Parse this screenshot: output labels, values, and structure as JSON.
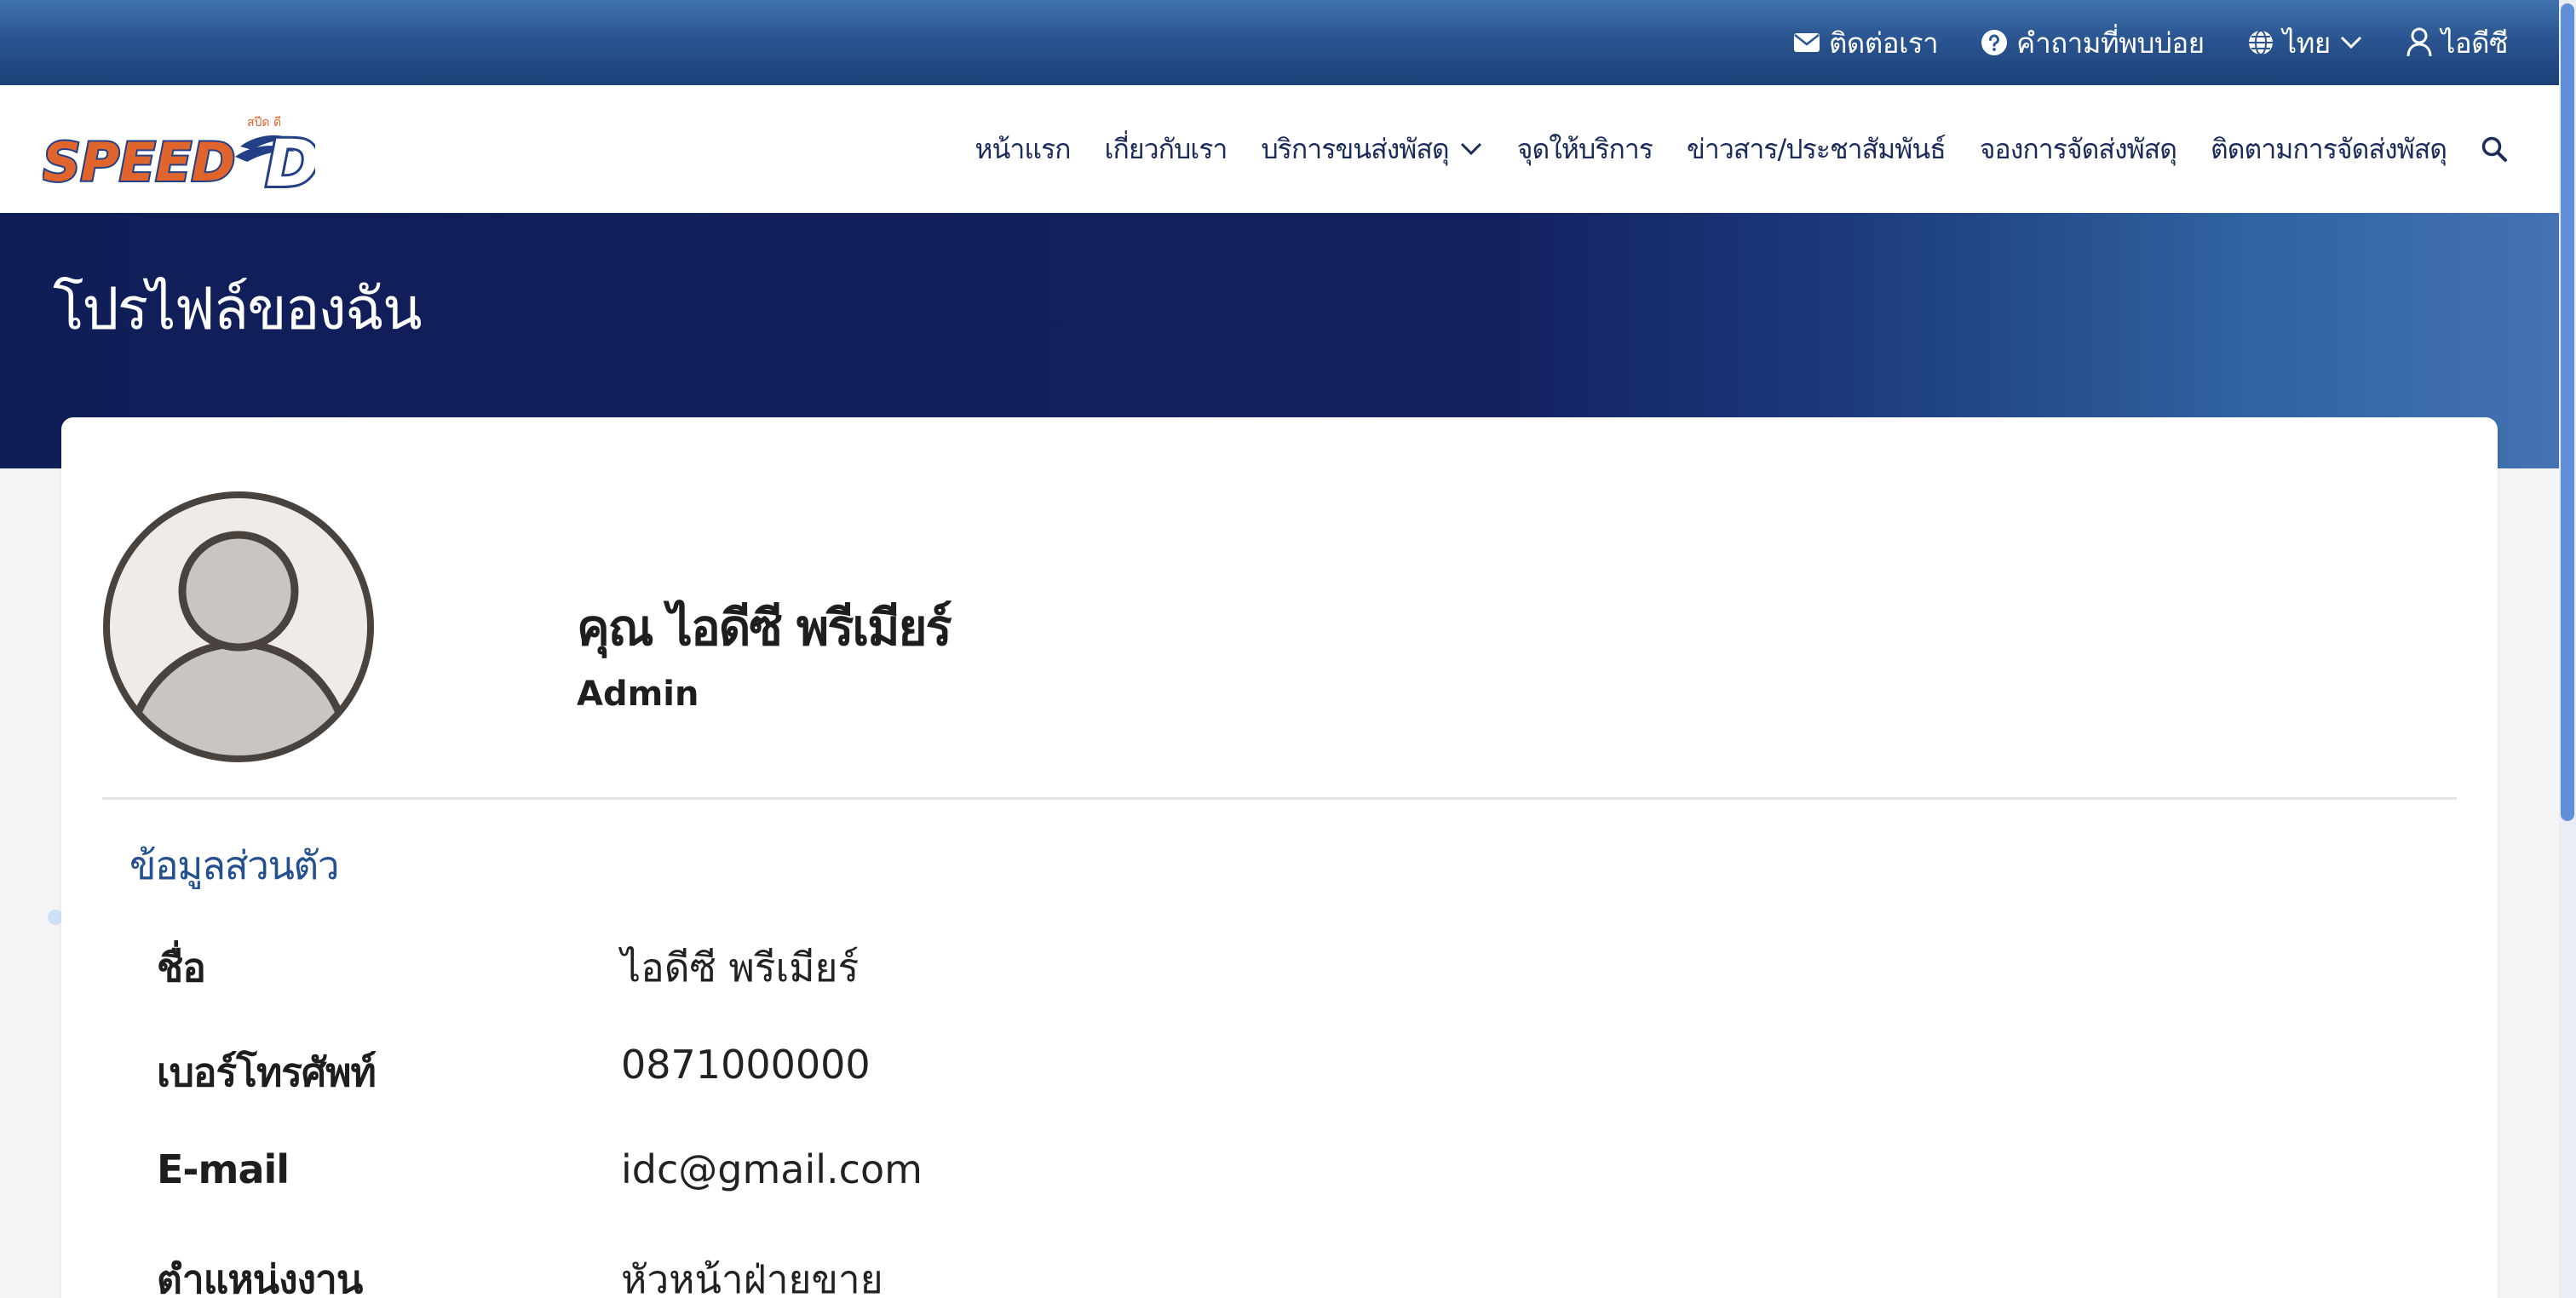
{
  "topbar": {
    "contact": "ติดต่อเรา",
    "faq": "คำถามที่พบบ่อย",
    "language": "ไทย",
    "user": "ไอดีซี"
  },
  "logo": {
    "text": "SPEED",
    "letter": "D",
    "tagline": "สปีด ดี"
  },
  "nav": {
    "items": [
      {
        "label": "หน้าแรก"
      },
      {
        "label": "เกี่ยวกับเรา"
      },
      {
        "label": "บริการขนส่งพัสดุ",
        "has_dropdown": true
      },
      {
        "label": "จุดให้บริการ"
      },
      {
        "label": "ข่าวสาร/ประชาสัมพันธ์"
      },
      {
        "label": "จองการจัดส่งพัสดุ"
      },
      {
        "label": "ติดตามการจัดส่งพัสดุ"
      }
    ]
  },
  "hero": {
    "title": "โปรไฟล์ของฉัน"
  },
  "profile": {
    "name": "คุณ ไอดีซี พรีเมียร์",
    "role": "Admin"
  },
  "personal_info": {
    "title": "ข้อมูลส่วนตัว",
    "rows": [
      {
        "label": "ชื่อ",
        "value": "ไอดีซี พรีเมียร์"
      },
      {
        "label": "เบอร์โทรศัพท์",
        "value": "0871000000"
      },
      {
        "label": "E-mail",
        "value": "idc@gmail.com"
      },
      {
        "label": "ตำแหน่งงาน",
        "value": "หัวหน้าฝ่ายขาย"
      }
    ]
  },
  "colors": {
    "topbar": "#2a5590",
    "hero": "#101e58",
    "nav_text": "#1b2b5a",
    "section_title": "#24508f",
    "logo_orange": "#e0652d",
    "logo_blue": "#233f86"
  }
}
